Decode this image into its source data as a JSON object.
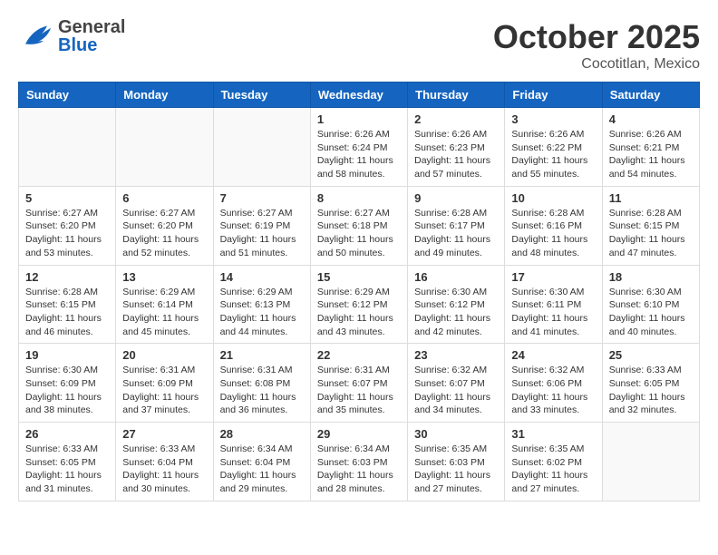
{
  "header": {
    "logo_general": "General",
    "logo_blue": "Blue",
    "month_title": "October 2025",
    "subtitle": "Cocotitlan, Mexico"
  },
  "weekdays": [
    "Sunday",
    "Monday",
    "Tuesday",
    "Wednesday",
    "Thursday",
    "Friday",
    "Saturday"
  ],
  "weeks": [
    [
      {
        "day": "",
        "info": ""
      },
      {
        "day": "",
        "info": ""
      },
      {
        "day": "",
        "info": ""
      },
      {
        "day": "1",
        "info": "Sunrise: 6:26 AM\nSunset: 6:24 PM\nDaylight: 11 hours\nand 58 minutes."
      },
      {
        "day": "2",
        "info": "Sunrise: 6:26 AM\nSunset: 6:23 PM\nDaylight: 11 hours\nand 57 minutes."
      },
      {
        "day": "3",
        "info": "Sunrise: 6:26 AM\nSunset: 6:22 PM\nDaylight: 11 hours\nand 55 minutes."
      },
      {
        "day": "4",
        "info": "Sunrise: 6:26 AM\nSunset: 6:21 PM\nDaylight: 11 hours\nand 54 minutes."
      }
    ],
    [
      {
        "day": "5",
        "info": "Sunrise: 6:27 AM\nSunset: 6:20 PM\nDaylight: 11 hours\nand 53 minutes."
      },
      {
        "day": "6",
        "info": "Sunrise: 6:27 AM\nSunset: 6:20 PM\nDaylight: 11 hours\nand 52 minutes."
      },
      {
        "day": "7",
        "info": "Sunrise: 6:27 AM\nSunset: 6:19 PM\nDaylight: 11 hours\nand 51 minutes."
      },
      {
        "day": "8",
        "info": "Sunrise: 6:27 AM\nSunset: 6:18 PM\nDaylight: 11 hours\nand 50 minutes."
      },
      {
        "day": "9",
        "info": "Sunrise: 6:28 AM\nSunset: 6:17 PM\nDaylight: 11 hours\nand 49 minutes."
      },
      {
        "day": "10",
        "info": "Sunrise: 6:28 AM\nSunset: 6:16 PM\nDaylight: 11 hours\nand 48 minutes."
      },
      {
        "day": "11",
        "info": "Sunrise: 6:28 AM\nSunset: 6:15 PM\nDaylight: 11 hours\nand 47 minutes."
      }
    ],
    [
      {
        "day": "12",
        "info": "Sunrise: 6:28 AM\nSunset: 6:15 PM\nDaylight: 11 hours\nand 46 minutes."
      },
      {
        "day": "13",
        "info": "Sunrise: 6:29 AM\nSunset: 6:14 PM\nDaylight: 11 hours\nand 45 minutes."
      },
      {
        "day": "14",
        "info": "Sunrise: 6:29 AM\nSunset: 6:13 PM\nDaylight: 11 hours\nand 44 minutes."
      },
      {
        "day": "15",
        "info": "Sunrise: 6:29 AM\nSunset: 6:12 PM\nDaylight: 11 hours\nand 43 minutes."
      },
      {
        "day": "16",
        "info": "Sunrise: 6:30 AM\nSunset: 6:12 PM\nDaylight: 11 hours\nand 42 minutes."
      },
      {
        "day": "17",
        "info": "Sunrise: 6:30 AM\nSunset: 6:11 PM\nDaylight: 11 hours\nand 41 minutes."
      },
      {
        "day": "18",
        "info": "Sunrise: 6:30 AM\nSunset: 6:10 PM\nDaylight: 11 hours\nand 40 minutes."
      }
    ],
    [
      {
        "day": "19",
        "info": "Sunrise: 6:30 AM\nSunset: 6:09 PM\nDaylight: 11 hours\nand 38 minutes."
      },
      {
        "day": "20",
        "info": "Sunrise: 6:31 AM\nSunset: 6:09 PM\nDaylight: 11 hours\nand 37 minutes."
      },
      {
        "day": "21",
        "info": "Sunrise: 6:31 AM\nSunset: 6:08 PM\nDaylight: 11 hours\nand 36 minutes."
      },
      {
        "day": "22",
        "info": "Sunrise: 6:31 AM\nSunset: 6:07 PM\nDaylight: 11 hours\nand 35 minutes."
      },
      {
        "day": "23",
        "info": "Sunrise: 6:32 AM\nSunset: 6:07 PM\nDaylight: 11 hours\nand 34 minutes."
      },
      {
        "day": "24",
        "info": "Sunrise: 6:32 AM\nSunset: 6:06 PM\nDaylight: 11 hours\nand 33 minutes."
      },
      {
        "day": "25",
        "info": "Sunrise: 6:33 AM\nSunset: 6:05 PM\nDaylight: 11 hours\nand 32 minutes."
      }
    ],
    [
      {
        "day": "26",
        "info": "Sunrise: 6:33 AM\nSunset: 6:05 PM\nDaylight: 11 hours\nand 31 minutes."
      },
      {
        "day": "27",
        "info": "Sunrise: 6:33 AM\nSunset: 6:04 PM\nDaylight: 11 hours\nand 30 minutes."
      },
      {
        "day": "28",
        "info": "Sunrise: 6:34 AM\nSunset: 6:04 PM\nDaylight: 11 hours\nand 29 minutes."
      },
      {
        "day": "29",
        "info": "Sunrise: 6:34 AM\nSunset: 6:03 PM\nDaylight: 11 hours\nand 28 minutes."
      },
      {
        "day": "30",
        "info": "Sunrise: 6:35 AM\nSunset: 6:03 PM\nDaylight: 11 hours\nand 27 minutes."
      },
      {
        "day": "31",
        "info": "Sunrise: 6:35 AM\nSunset: 6:02 PM\nDaylight: 11 hours\nand 27 minutes."
      },
      {
        "day": "",
        "info": ""
      }
    ]
  ]
}
